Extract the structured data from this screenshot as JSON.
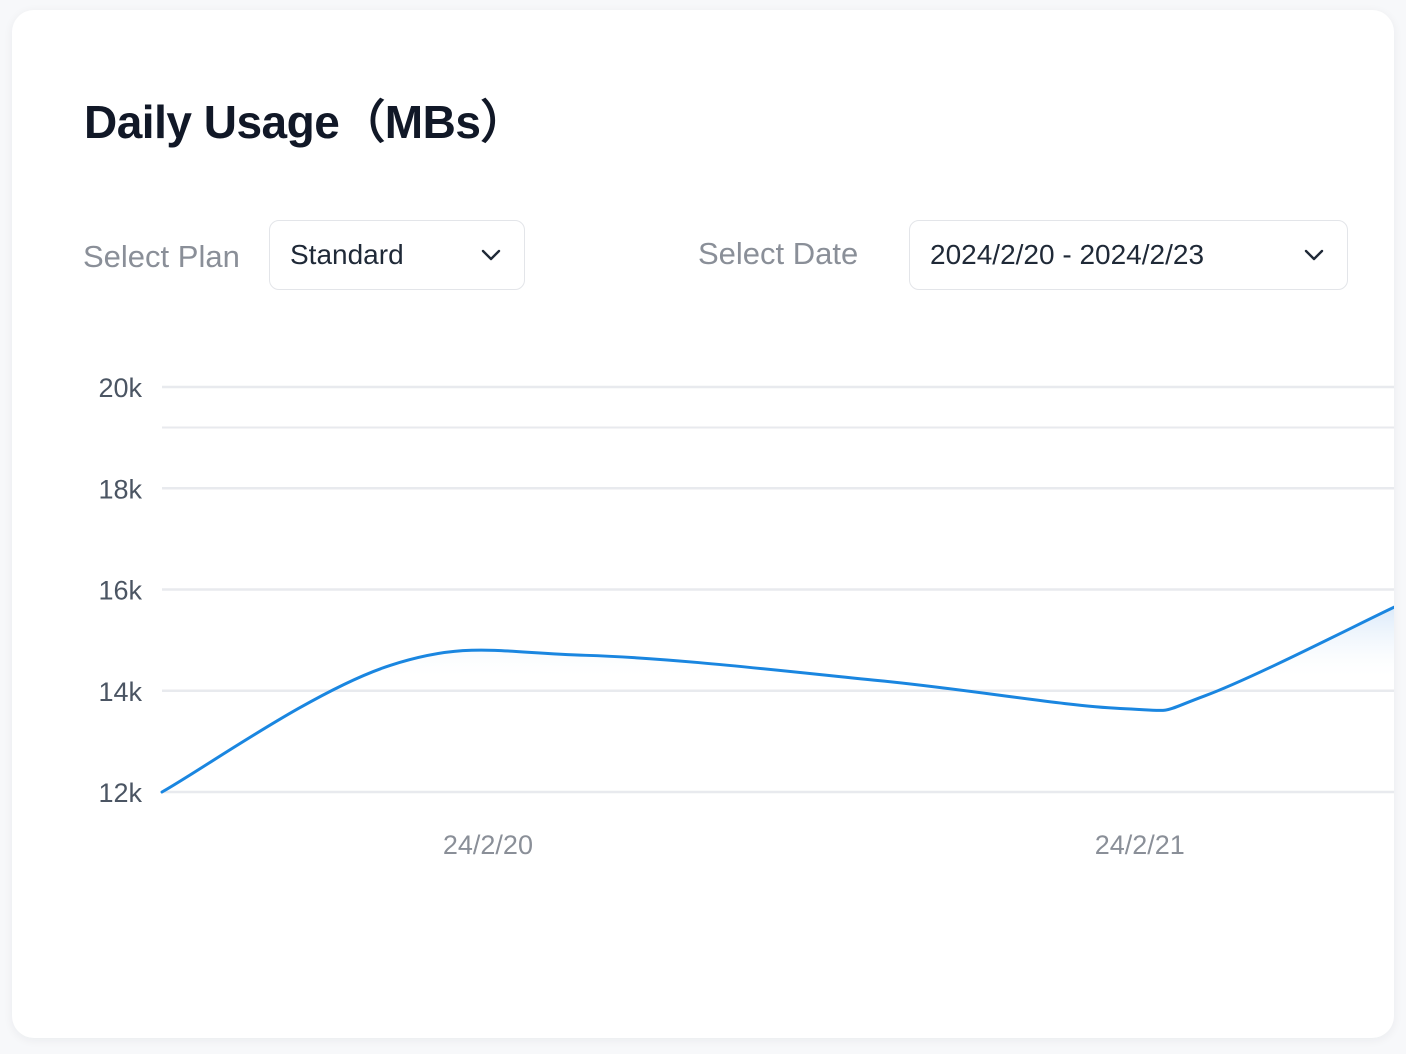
{
  "card": {
    "title": "Daily Usage（MBs）"
  },
  "filters": {
    "plan_label": "Select Plan",
    "plan_value": "Standard",
    "date_label": "Select Date",
    "date_value": "2024/2/20 - 2024/2/23"
  },
  "colors": {
    "line": "#1a86e0",
    "area_top": "#cfe3f8",
    "grid": "#e8eaee"
  },
  "chart_data": {
    "type": "area",
    "title": "Daily Usage（MBs）",
    "xlabel": "",
    "ylabel": "",
    "ylim": [
      12000,
      20000
    ],
    "y_ticks": [
      {
        "value": 12000,
        "label": "12k"
      },
      {
        "value": 14000,
        "label": "14k"
      },
      {
        "value": 16000,
        "label": "16k"
      },
      {
        "value": 18000,
        "label": "18k"
      },
      {
        "value": 20000,
        "label": "20k"
      }
    ],
    "x_ticks": [
      {
        "value": 0.5,
        "label": "24/2/20"
      },
      {
        "value": 1.5,
        "label": "24/2/21"
      }
    ],
    "xlim": [
      0,
      1.89
    ],
    "grid": true,
    "legend": "none",
    "series": [
      {
        "values": [
          {
            "x": 0.0,
            "y": 12000
          },
          {
            "x": 0.35,
            "y": 14500
          },
          {
            "x": 0.65,
            "y": 14700
          },
          {
            "x": 1.1,
            "y": 14200
          },
          {
            "x": 1.47,
            "y": 13650
          },
          {
            "x": 1.6,
            "y": 13900
          },
          {
            "x": 1.89,
            "y": 15650
          }
        ]
      }
    ]
  }
}
